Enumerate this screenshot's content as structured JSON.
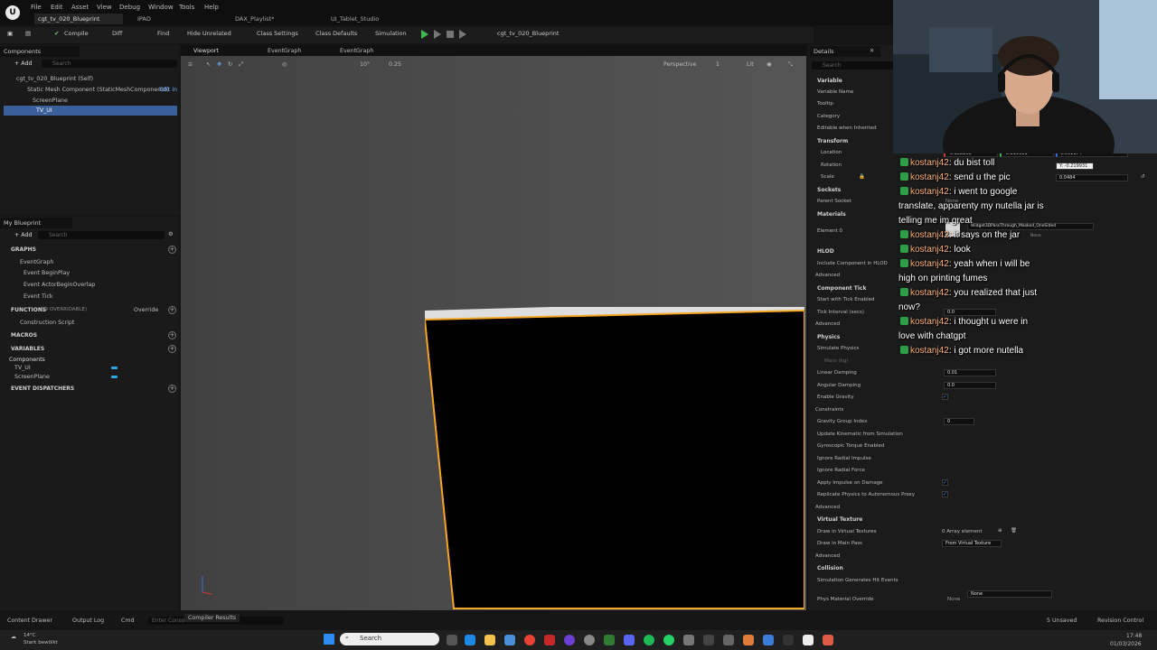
{
  "app": {
    "menus": [
      "File",
      "Edit",
      "Asset",
      "View",
      "Debug",
      "Window",
      "Tools",
      "Help"
    ],
    "tabs": [
      "cgt_tv_020_Blueprint",
      "IPAD",
      "DAX_Playlist*",
      "UI_Tablet_Studio"
    ]
  },
  "toolbar": {
    "compile": "Compile",
    "diff": "Diff",
    "find": "Find",
    "hide_unrelated": "Hide Unrelated",
    "class_settings": "Class Settings",
    "class_defaults": "Class Defaults",
    "simulation": "Simulation",
    "debug_object": "cgt_tv_020_Blueprint"
  },
  "components": {
    "title": "Components",
    "add": "+ Add",
    "search_placeholder": "Search",
    "root": "cgt_tv_020_Blueprint (Self)",
    "mesh": "Static Mesh Component (StaticMeshComponent0)",
    "edit_in": "Edit in",
    "items": [
      "ScreenPlane",
      "TV_UI"
    ]
  },
  "myblueprint": {
    "title": "My Blueprint",
    "add": "+ Add",
    "search_placeholder": "Search",
    "graphs_header": "GRAPHS",
    "graph": "EventGraph",
    "events": [
      "Event BeginPlay",
      "Event ActorBeginOverlap",
      "Event Tick"
    ],
    "functions_header": "FUNCTIONS",
    "functions_note": "(19 OVERRIDABLE)",
    "override": "Override",
    "function_items": [
      "Construction Script"
    ],
    "macros_header": "MACROS",
    "variables_header": "VARIABLES",
    "components_group": "Components",
    "variable_items": [
      "TV_UI",
      "ScreenPlane"
    ],
    "dispatchers_header": "EVENT DISPATCHERS"
  },
  "center_tabs": [
    "Viewport",
    "EventGraph",
    "EventGraph"
  ],
  "viewport": {
    "perspective": "Perspective",
    "lit": "Lit",
    "grid_snap": "10°",
    "scale_snap": "0.25",
    "camera_speed": "1"
  },
  "details": {
    "title": "Details",
    "search_placeholder": "Search",
    "variable_section": "Variable",
    "variable_rows": [
      "Variable Name",
      "Tooltip",
      "Category",
      "Editable when Inherited"
    ],
    "transform_section": "Transform",
    "location_label": "Location",
    "rotation_label": "Rotation",
    "scale_label": "Scale",
    "location_values": [
      "-0.158263",
      "-0.219931",
      "0.051174"
    ],
    "tooltip_value": "Y: -0.219931",
    "scale_value": "0.0484",
    "sockets_section": "Sockets",
    "parent_socket": "Parent Socket",
    "parent_socket_value": "None",
    "materials_section": "Materials",
    "element0": "Element 0",
    "material_value": "Widget3DPassThrough_Masked_OneSided",
    "material_none": "None",
    "hlod_section": "HLOD",
    "hlod_row": "Include Component in HLOD",
    "advanced": "Advanced",
    "tick_section": "Component Tick",
    "tick_rows": [
      "Start with Tick Enabled",
      "Tick Interval (secs)"
    ],
    "tick_interval": "0.0",
    "physics_section": "Physics",
    "physics_rows": [
      "Simulate Physics",
      "Mass (kg)",
      "Linear Damping",
      "Angular Damping",
      "Enable Gravity"
    ],
    "linear_damping": "0.01",
    "angular_damping": "0.0",
    "constraints": "Constraints",
    "gravity_group": "Gravity Group Index",
    "gravity_group_value": "0",
    "more_physics": [
      "Update Kinematic from Simulation",
      "Gyroscopic Torque Enabled",
      "Ignore Radial Impulse",
      "Ignore Radial Force",
      "Apply Impulse on Damage",
      "Replicate Physics to Autonomous Proxy"
    ],
    "virtual_texture_section": "Virtual Texture",
    "draw_in_vt": "Draw in Virtual Textures",
    "array_elements": "0 Array element",
    "draw_in_main": "Draw in Main Pass",
    "main_pass_value": "From Virtual Texture",
    "collision_section": "Collision",
    "sim_hit": "Simulation Generates Hit Events",
    "phys_material": "Phys Material Override",
    "phys_value": "None",
    "phys_none": "None"
  },
  "chat": [
    {
      "user": "kostanj42",
      "text": "du bist toll"
    },
    {
      "user": "kostanj42",
      "text": "send u the pic"
    },
    {
      "user": "kostanj42",
      "text": "i went to google",
      "cont": "translate, apparenty my nutella jar is"
    },
    {
      "user": "",
      "text": "",
      "cont": "telling me im great"
    },
    {
      "user": "kostanj42",
      "text": "it says on the jar"
    },
    {
      "user": "kostanj42",
      "text": "look"
    },
    {
      "user": "kostanj42",
      "text": "yeah when i will be",
      "cont": "high on printing fumes"
    },
    {
      "user": "kostanj42",
      "text": "you realized that just",
      "cont": "now?"
    },
    {
      "user": "kostanj42",
      "text": "i thought u were in",
      "cont": "love with chatgpt"
    },
    {
      "user": "kostanj42",
      "text": "i got more nutella"
    }
  ],
  "statusbar": {
    "content_drawer": "Content Drawer",
    "output_log": "Output Log",
    "cmd": "Cmd",
    "console_placeholder": "Enter Console Command",
    "compiler_results": "Compiler Results",
    "unsaved": "5 Unsaved",
    "revision": "Revision Control"
  },
  "taskbar": {
    "weather_temp": "14°C",
    "weather_desc": "Stark bewölkt",
    "search": "Search",
    "time": "17:48",
    "date": "01/03/2026"
  },
  "colors": {
    "accent": "#f5a623",
    "selection": "#3a5f9a",
    "chat_user": "#ffb37a"
  }
}
